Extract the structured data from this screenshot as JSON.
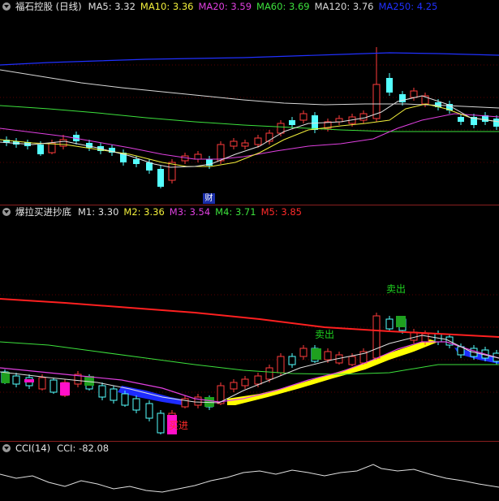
{
  "price_panel": {
    "title": "福石控股 (日线)",
    "ma": [
      {
        "label": "MA5: ",
        "value": "3.32",
        "color": "#e0e0e0"
      },
      {
        "label": "MA10: ",
        "value": "3.36",
        "color": "#f2ef3b"
      },
      {
        "label": "MA20: ",
        "value": "3.59",
        "color": "#e040e0"
      },
      {
        "label": "MA60: ",
        "value": "3.69",
        "color": "#3ce03c"
      },
      {
        "label": "MA120: ",
        "value": "3.76",
        "color": "#d8d8d8"
      },
      {
        "label": "MA250: ",
        "value": "4.25",
        "color": "#2030ff"
      }
    ],
    "badge": "财"
  },
  "indicator_panel": {
    "title": "爆拉买进抄底",
    "m": [
      {
        "label": "M1: ",
        "value": "3.30",
        "color": "#e0e0e0"
      },
      {
        "label": "M2: ",
        "value": "3.36",
        "color": "#f2ef3b"
      },
      {
        "label": "M3: ",
        "value": "3.54",
        "color": "#e040e0"
      },
      {
        "label": "M4: ",
        "value": "3.71",
        "color": "#3ce03c"
      },
      {
        "label": "M5: ",
        "value": "3.85",
        "color": "#ff2a2a"
      }
    ],
    "signals": {
      "buy": "买进",
      "sell1": "卖出",
      "sell2": "卖出"
    }
  },
  "cci_panel": {
    "name": "CCI(14)",
    "label": "CCI: ",
    "value": "-82.08"
  },
  "colors": {
    "up": "#ff3b3b",
    "down": "#54ffff",
    "bg": "#000000",
    "sell": "#1fd21f",
    "buy": "#ff2a2a"
  }
}
